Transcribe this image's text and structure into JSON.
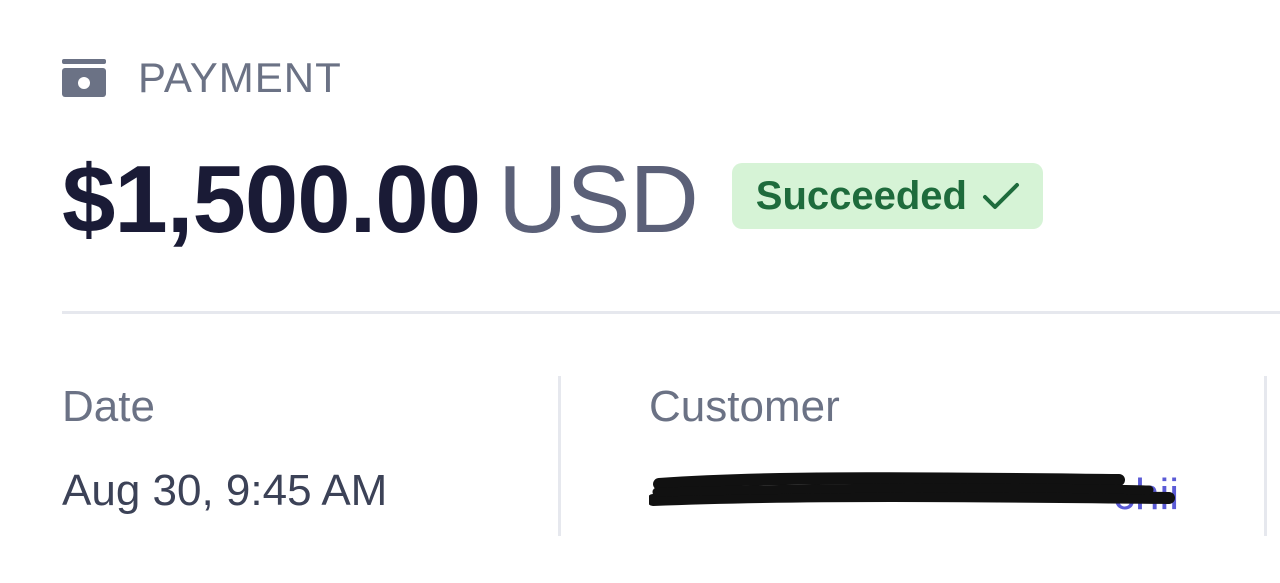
{
  "header": {
    "kind_icon": "wallet-icon",
    "kind_label": "PAYMENT"
  },
  "amount": {
    "value": "$1,500.00",
    "currency": "USD"
  },
  "status": {
    "label": "Succeeded",
    "icon": "checkmark-icon",
    "colors": {
      "background": "#d6f3d6",
      "text": "#1e6b3c"
    }
  },
  "details": {
    "date": {
      "label": "Date",
      "value": "Aug 30, 9:45 AM"
    },
    "customer": {
      "label": "Customer",
      "value_visible": "chii",
      "redacted": true
    }
  },
  "colors": {
    "amount": "#1a1b36",
    "currency": "#5b6078",
    "muted_label": "#6b7285",
    "link": "#5b5bd6",
    "divider": "#e6e8ee"
  }
}
